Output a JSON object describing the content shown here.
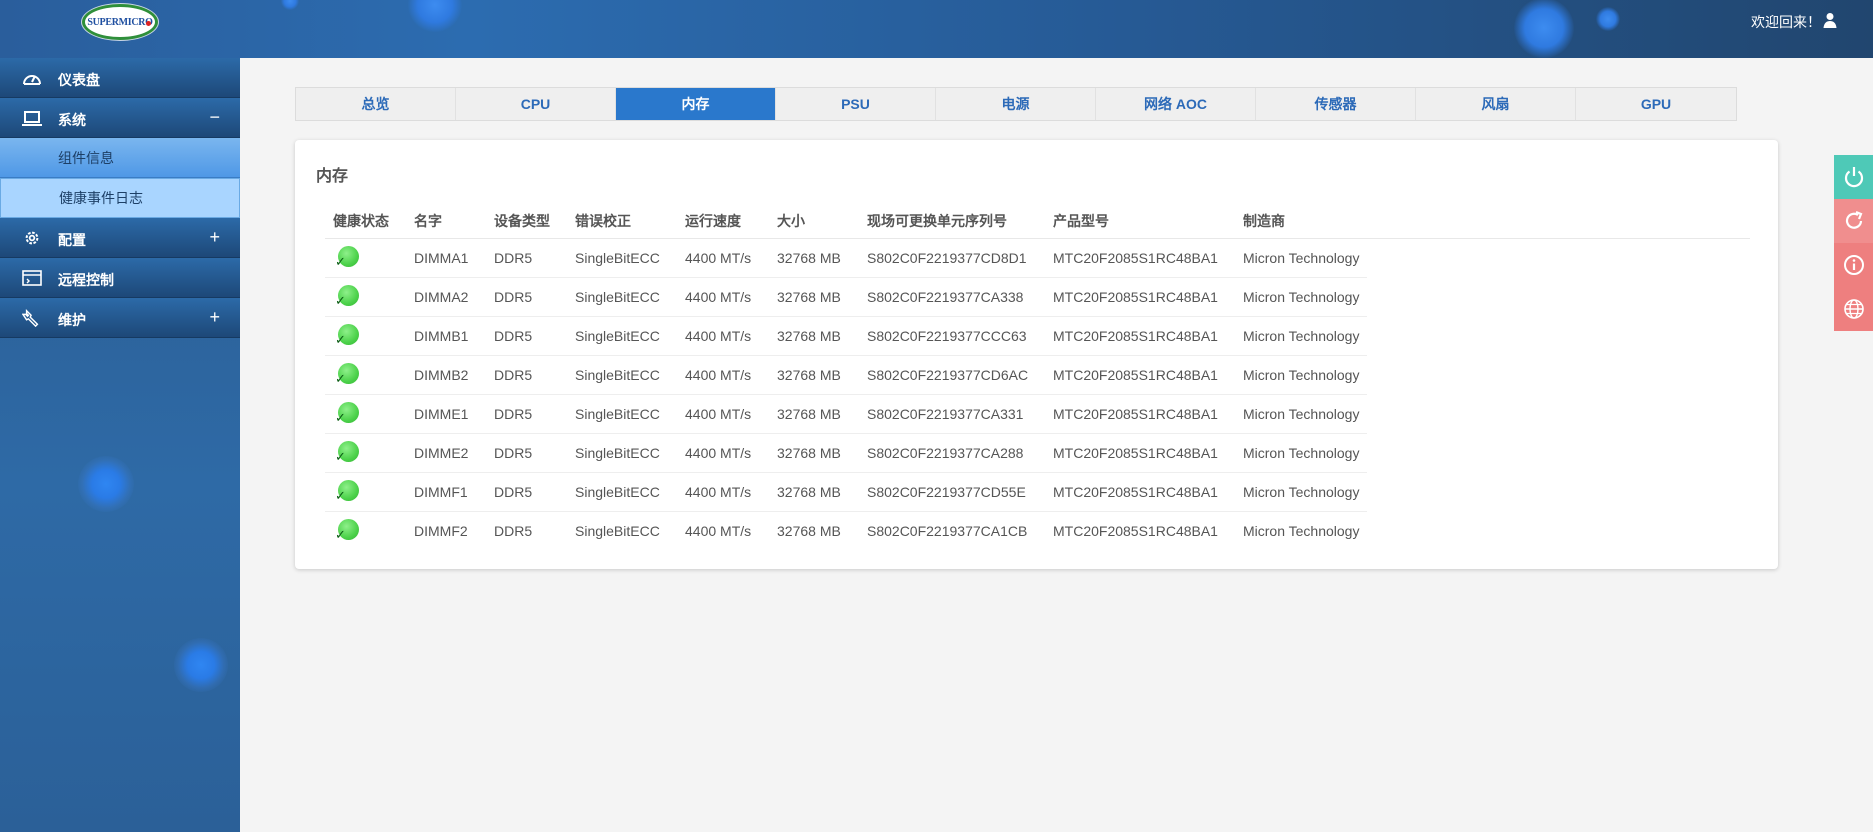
{
  "header": {
    "brand": "SUPERMICRO",
    "welcome": "欢迎回来！"
  },
  "sidebar": {
    "items": [
      {
        "label": "仪表盘",
        "icon": "dashboard-gauge-icon",
        "toggle": ""
      },
      {
        "label": "系统",
        "icon": "laptop-icon",
        "toggle": "−"
      },
      {
        "label": "配置",
        "icon": "gear-icon",
        "toggle": "+"
      },
      {
        "label": "远程控制",
        "icon": "console-window-icon",
        "toggle": ""
      },
      {
        "label": "维护",
        "icon": "wrench-icon",
        "toggle": "+"
      }
    ],
    "subitems": [
      {
        "label": "组件信息"
      },
      {
        "label": "健康事件日志"
      }
    ]
  },
  "tabs": [
    {
      "label": "总览"
    },
    {
      "label": "CPU"
    },
    {
      "label": "内存",
      "active": true
    },
    {
      "label": "PSU"
    },
    {
      "label": "电源"
    },
    {
      "label": "网络 AOC"
    },
    {
      "label": "传感器"
    },
    {
      "label": "风扇"
    },
    {
      "label": "GPU"
    }
  ],
  "memory": {
    "title": "内存",
    "columns": [
      "健康状态",
      "名字",
      "设备类型",
      "错误校正",
      "运行速度",
      "大小",
      "现场可更换单元序列号",
      "产品型号",
      "制造商"
    ],
    "rows": [
      {
        "status": "ok",
        "name": "DIMMA1",
        "type": "DDR5",
        "ecc": "SingleBitECC",
        "speed": "4400 MT/s",
        "size": "32768 MB",
        "serial": "S802C0F2219377CD8D1",
        "model": "MTC20F2085S1RC48BA1",
        "vendor": "Micron Technology"
      },
      {
        "status": "ok",
        "name": "DIMMA2",
        "type": "DDR5",
        "ecc": "SingleBitECC",
        "speed": "4400 MT/s",
        "size": "32768 MB",
        "serial": "S802C0F2219377CA338",
        "model": "MTC20F2085S1RC48BA1",
        "vendor": "Micron Technology"
      },
      {
        "status": "ok",
        "name": "DIMMB1",
        "type": "DDR5",
        "ecc": "SingleBitECC",
        "speed": "4400 MT/s",
        "size": "32768 MB",
        "serial": "S802C0F2219377CCC63",
        "model": "MTC20F2085S1RC48BA1",
        "vendor": "Micron Technology"
      },
      {
        "status": "ok",
        "name": "DIMMB2",
        "type": "DDR5",
        "ecc": "SingleBitECC",
        "speed": "4400 MT/s",
        "size": "32768 MB",
        "serial": "S802C0F2219377CD6AC",
        "model": "MTC20F2085S1RC48BA1",
        "vendor": "Micron Technology"
      },
      {
        "status": "ok",
        "name": "DIMME1",
        "type": "DDR5",
        "ecc": "SingleBitECC",
        "speed": "4400 MT/s",
        "size": "32768 MB",
        "serial": "S802C0F2219377CA331",
        "model": "MTC20F2085S1RC48BA1",
        "vendor": "Micron Technology"
      },
      {
        "status": "ok",
        "name": "DIMME2",
        "type": "DDR5",
        "ecc": "SingleBitECC",
        "speed": "4400 MT/s",
        "size": "32768 MB",
        "serial": "S802C0F2219377CA288",
        "model": "MTC20F2085S1RC48BA1",
        "vendor": "Micron Technology"
      },
      {
        "status": "ok",
        "name": "DIMMF1",
        "type": "DDR5",
        "ecc": "SingleBitECC",
        "speed": "4400 MT/s",
        "size": "32768 MB",
        "serial": "S802C0F2219377CD55E",
        "model": "MTC20F2085S1RC48BA1",
        "vendor": "Micron Technology"
      },
      {
        "status": "ok",
        "name": "DIMMF2",
        "type": "DDR5",
        "ecc": "SingleBitECC",
        "speed": "4400 MT/s",
        "size": "32768 MB",
        "serial": "S802C0F2219377CA1CB",
        "model": "MTC20F2085S1RC48BA1",
        "vendor": "Micron Technology"
      }
    ]
  },
  "quick_actions": [
    {
      "icon": "power-icon",
      "color": "#4ec9b7"
    },
    {
      "icon": "refresh-icon",
      "color": "#f08e8e"
    },
    {
      "icon": "info-icon",
      "color": "#ee7f7f"
    },
    {
      "icon": "globe-icon",
      "color": "#ee7f7f"
    }
  ],
  "colors": {
    "accent": "#2a78cc",
    "header": "#2a5e9c",
    "status_ok": "#4cd14a"
  }
}
